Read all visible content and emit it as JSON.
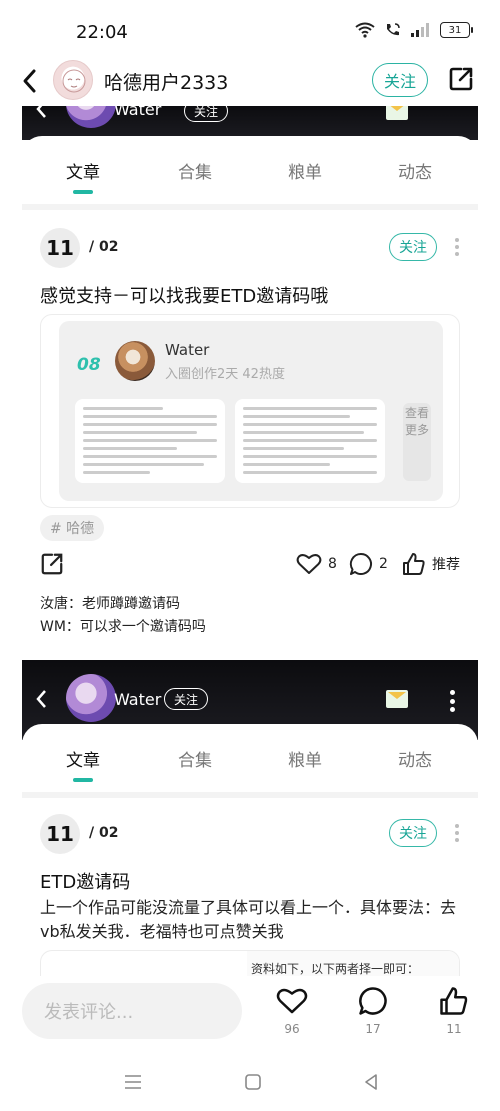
{
  "status": {
    "time": "22:04",
    "battery": "31"
  },
  "header": {
    "username": "哈德用户2333",
    "follow_label": "关注"
  },
  "banner": {
    "name": "Water",
    "follow_label": "关注"
  },
  "tabs": [
    "文章",
    "合集",
    "粮单",
    "动态"
  ],
  "posts": [
    {
      "page": "11",
      "total": "/ 02",
      "follow_label": "关注",
      "title": "感觉支持－可以找我要ETD邀请码哦",
      "preview": {
        "number": "08",
        "author": "Water",
        "meta": "入圈创作2天   42热度",
        "more": "查看更多"
      },
      "tag": "# 哈德",
      "likes": "8",
      "comments": "2",
      "recommend": "推荐",
      "comment_list": [
        "汝唐：老师蹲蹲邀请码",
        "WM：可以求一个邀请码吗"
      ]
    },
    {
      "page": "11",
      "total": "/ 02",
      "follow_label": "关注",
      "title": "ETD邀请码",
      "body": "上一个作品可能没流量了具体可以看上一个．具体要法：去vb私发关我．老福特也可点赞关我",
      "preview_snippet": "资料如下，以下两者择一即可："
    }
  ],
  "bottom": {
    "comment_placeholder": "发表评论...",
    "likes": "96",
    "comments": "17",
    "thumbs": "11"
  },
  "colors": {
    "accent": "#21b7a3",
    "banner": "#111115"
  }
}
